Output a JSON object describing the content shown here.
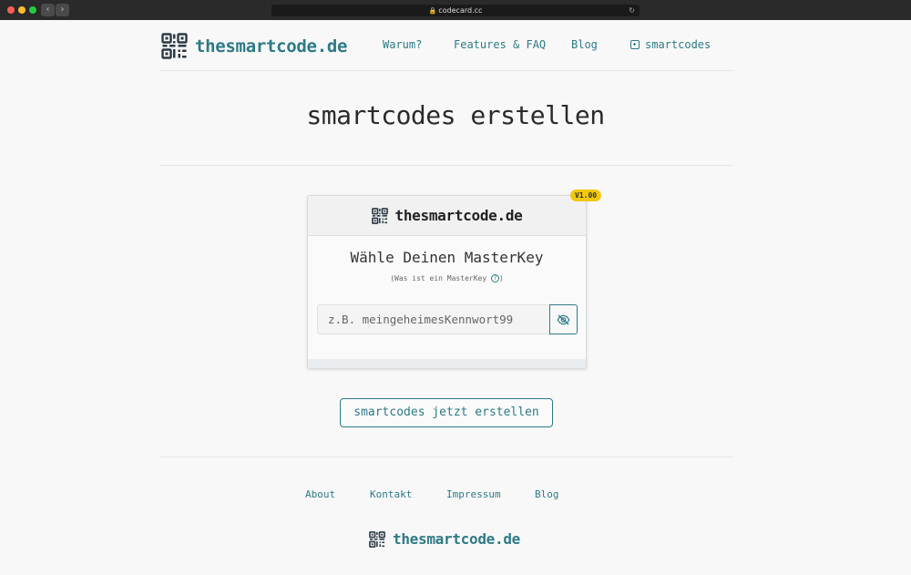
{
  "browser": {
    "url": "codecard.cc"
  },
  "header": {
    "brand_prefix": "the",
    "brand_main": "smartcode",
    "brand_suffix": ".de",
    "nav": {
      "warum": "Warum?",
      "features": "Features & FAQ",
      "blog": "Blog",
      "smartcodes": "smartcodes"
    }
  },
  "main": {
    "title": "smartcodes erstellen"
  },
  "card": {
    "version_badge": "V1.00",
    "brand_prefix": "the",
    "brand_main": "smartcode",
    "brand_suffix": ".de",
    "heading": "Wähle Deinen MasterKey",
    "help_text": "(Was ist ein MasterKey",
    "help_close": ")",
    "help_icon": "?",
    "masterkey_placeholder": "z.B. meingeheimesKennwort99",
    "masterkey_value": ""
  },
  "cta": {
    "label": "smartcodes jetzt erstellen"
  },
  "footer": {
    "links": {
      "about": "About",
      "kontakt": "Kontakt",
      "impressum": "Impressum",
      "blog": "Blog"
    },
    "brand_prefix": "the",
    "brand_main": "smartcode",
    "brand_suffix": ".de"
  },
  "colors": {
    "accent": "#2e7a86",
    "badge": "#f2c811"
  },
  "icons": {
    "logo": "qr-code-icon",
    "toggle_visibility": "eye-off-icon",
    "add": "plus-square-icon",
    "help": "question-circle-icon"
  }
}
